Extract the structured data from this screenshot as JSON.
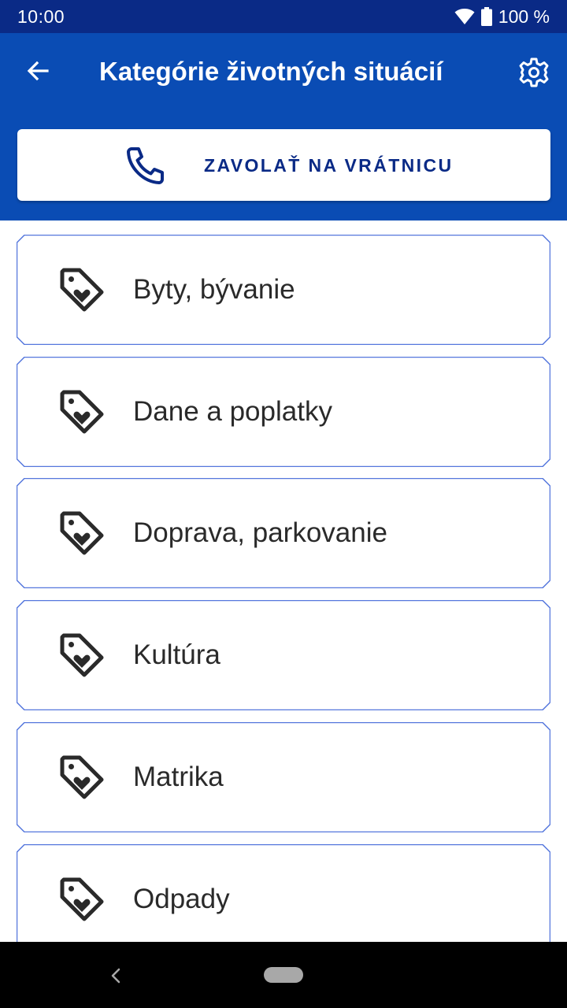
{
  "status_bar": {
    "time": "10:00",
    "battery": "100 %",
    "icons": [
      "wifi-icon",
      "battery-icon"
    ]
  },
  "app_bar": {
    "title": "Kategórie životných situácií",
    "back_icon": "arrow-left-icon",
    "settings_icon": "gear-icon"
  },
  "call_button": {
    "label": "ZAVOLAŤ NA VRÁTNICU",
    "icon": "phone-icon"
  },
  "categories": [
    {
      "label": "Byty, bývanie",
      "icon": "tag-heart-icon"
    },
    {
      "label": "Dane a poplatky",
      "icon": "tag-heart-icon"
    },
    {
      "label": "Doprava, parkovanie",
      "icon": "tag-heart-icon"
    },
    {
      "label": "Kultúra",
      "icon": "tag-heart-icon"
    },
    {
      "label": "Matrika",
      "icon": "tag-heart-icon"
    },
    {
      "label": "Odpady",
      "icon": "tag-heart-icon"
    }
  ],
  "navigation": {
    "back_icon": "nav-back-icon",
    "home_icon": "nav-home-pill"
  },
  "colors": {
    "status_bar": "#0a2a86",
    "app_bar": "#0a4cb4",
    "accent_text": "#0a2a86",
    "card_border": "#5577dd"
  }
}
